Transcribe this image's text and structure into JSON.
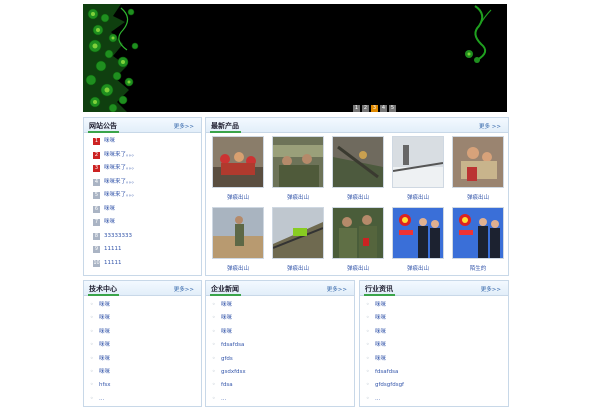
{
  "banner": {
    "pages": [
      "1",
      "2",
      "3",
      "4",
      "5"
    ],
    "active_page": "3"
  },
  "announcements": {
    "title": "网站公告",
    "more": "更多>>",
    "items": [
      {
        "num": "1",
        "text": "咪咪",
        "hot": true
      },
      {
        "num": "2",
        "text": "咪咪来了。。。",
        "hot": true
      },
      {
        "num": "3",
        "text": "咪咪来了。。。",
        "hot": true
      },
      {
        "num": "4",
        "text": "咪咪来了。。。",
        "hot": false
      },
      {
        "num": "5",
        "text": "咪咪来了。。。",
        "hot": false
      },
      {
        "num": "6",
        "text": "咪咪",
        "hot": false
      },
      {
        "num": "7",
        "text": "咪咪",
        "hot": false
      },
      {
        "num": "8",
        "text": "33333333",
        "hot": false
      },
      {
        "num": "9",
        "text": "11111",
        "hot": false
      },
      {
        "num": "10",
        "text": "11111",
        "hot": false
      }
    ]
  },
  "products": {
    "title": "最新产品",
    "more": "更多 >>",
    "items": [
      {
        "caption": "弹痕出山",
        "scene": "rescue-crowd"
      },
      {
        "caption": "弹痕出山",
        "scene": "soldiers-camo"
      },
      {
        "caption": "弹痕出山",
        "scene": "debris"
      },
      {
        "caption": "弹痕出山",
        "scene": "snow-rail"
      },
      {
        "caption": "弹痕出山",
        "scene": "carry"
      },
      {
        "caption": "弹痕出山",
        "scene": "desert-soldier"
      },
      {
        "caption": "弹痕出山",
        "scene": "railway"
      },
      {
        "caption": "弹痕出山",
        "scene": "troops"
      },
      {
        "caption": "弹痕出山",
        "scene": "police-flag"
      },
      {
        "caption": "陌生的",
        "scene": "police-flag"
      }
    ]
  },
  "tech": {
    "title": "技术中心",
    "more": "更多>>",
    "items": [
      "咪咪",
      "咪咪",
      "咪咪",
      "咪咪",
      "咪咪",
      "咪咪",
      "hfsx",
      "..."
    ]
  },
  "news": {
    "title": "企业新闻",
    "more": "更多>>",
    "items": [
      "咪咪",
      "咪咪",
      "咪咪",
      "fdsafdsa",
      "gfds",
      "gsdxfdsx",
      "fdsa",
      "..."
    ]
  },
  "industry": {
    "title": "行业资讯",
    "more": "更多>>",
    "items": [
      "咪咪",
      "咪咪",
      "咪咪",
      "咪咪",
      "咪咪",
      "fdsafdsa",
      "gfdsgfdsgf",
      "..."
    ]
  }
}
